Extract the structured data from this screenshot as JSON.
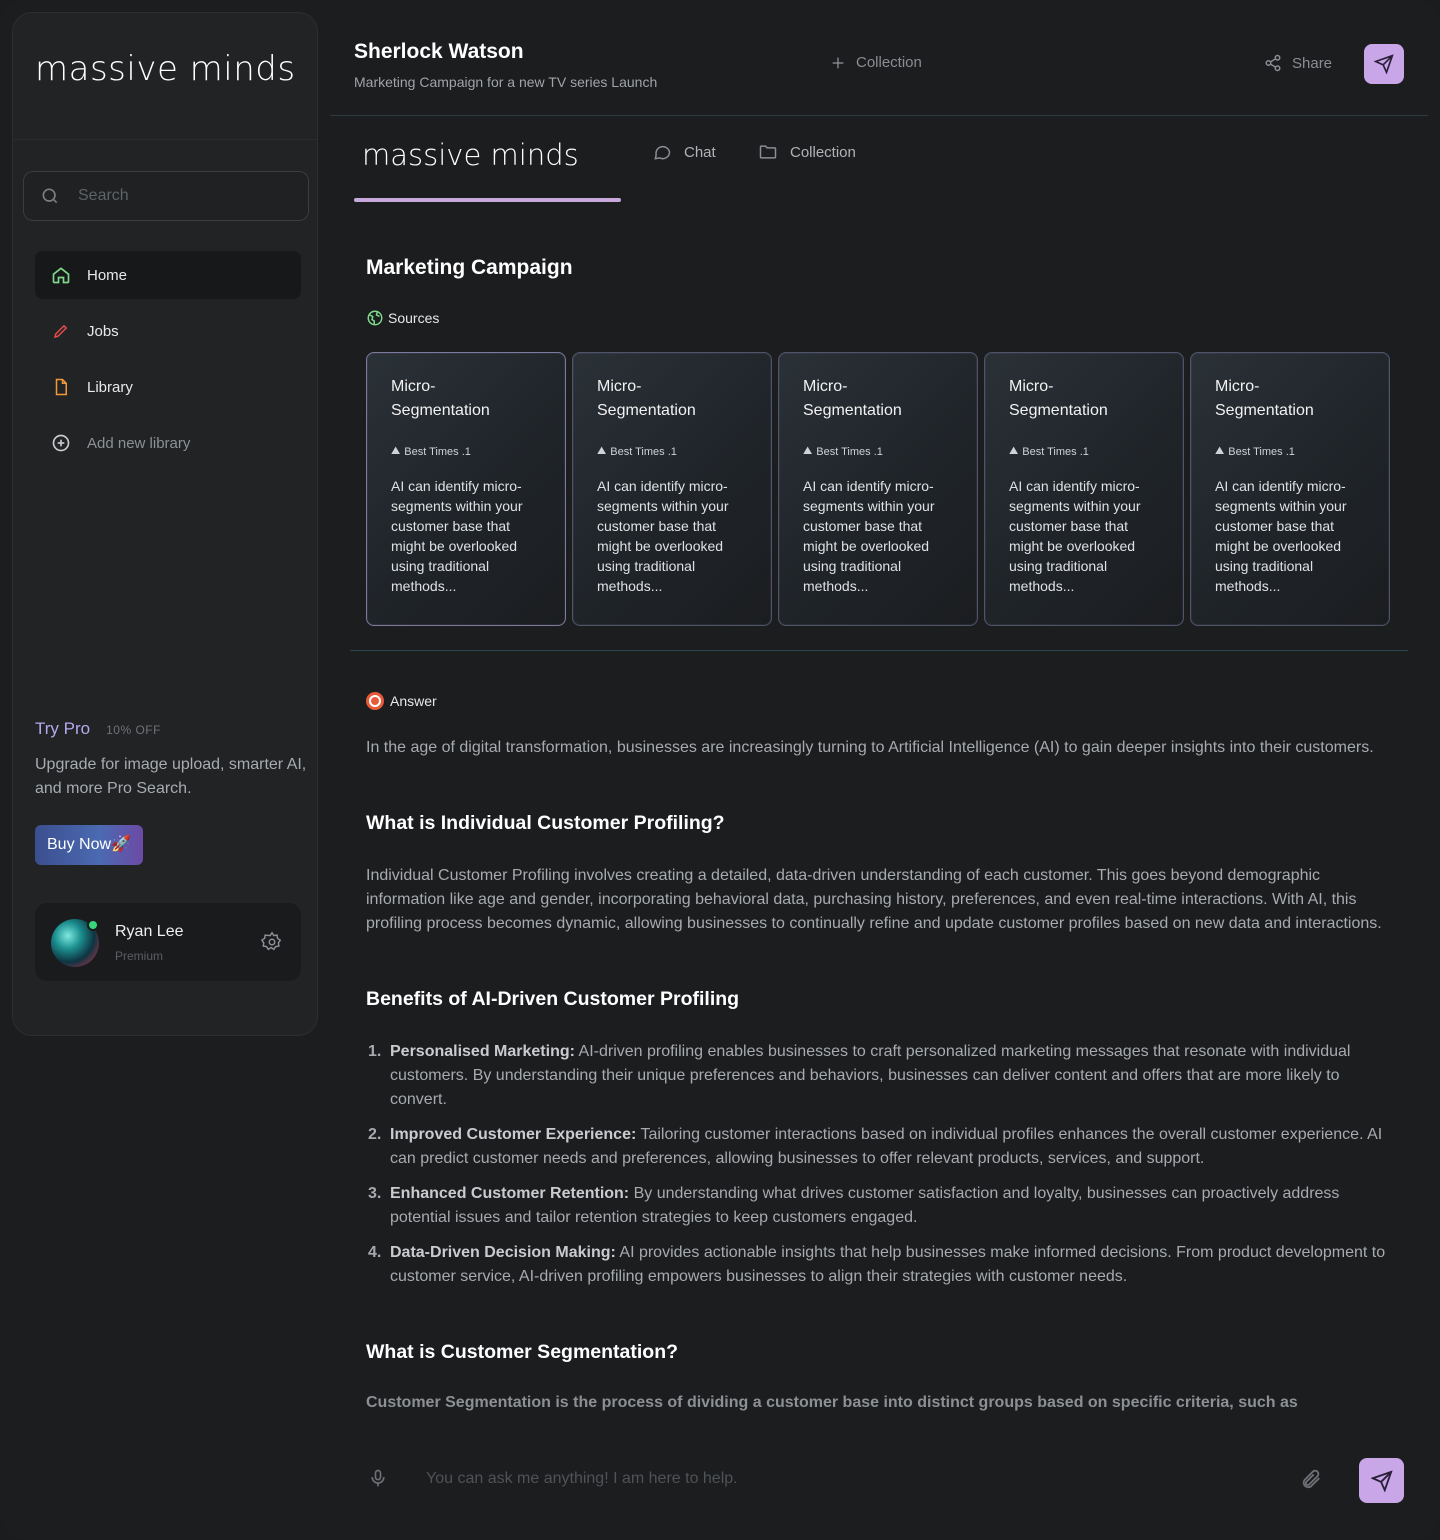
{
  "sidebar": {
    "logo": "massive  minds",
    "search_placeholder": "Search",
    "nav": [
      {
        "label": "Home",
        "icon": "home-icon"
      },
      {
        "label": "Jobs",
        "icon": "pencil-icon"
      },
      {
        "label": "Library",
        "icon": "file-icon"
      },
      {
        "label": "Add new library",
        "icon": "plus-circle-icon"
      }
    ],
    "trypro": {
      "title": "Try Pro",
      "badge": "10% OFF",
      "desc": "Upgrade for image upload, smarter AI, and more Pro Search.",
      "button": "Buy Now🚀"
    },
    "profile": {
      "name": "Ryan Lee",
      "tier": "Premium"
    }
  },
  "header": {
    "title": "Sherlock Watson",
    "subtitle": "Marketing Campaign for a new TV series Launch",
    "collection": "Collection",
    "share": "Share"
  },
  "tabs": {
    "brand": "massive  minds",
    "chat": "Chat",
    "collection": "Collection"
  },
  "content": {
    "heading": "Marketing Campaign",
    "sources_label": "Sources",
    "cards": [
      {
        "title": "Micro-\nSegmentation",
        "meta": "Best Times .1",
        "body": "AI can identify micro-segments within your customer base that might be overlooked using traditional methods..."
      },
      {
        "title": "Micro-\nSegmentation",
        "meta": "Best Times .1",
        "body": "AI can identify micro-segments within your customer base that might be overlooked using traditional methods..."
      },
      {
        "title": "Micro-\nSegmentation",
        "meta": "Best Times .1",
        "body": "AI can identify micro-segments within your customer base that might be overlooked using traditional methods..."
      },
      {
        "title": "Micro-\nSegmentation",
        "meta": "Best Times .1",
        "body": "AI can identify micro-segments within your customer base that might be overlooked using traditional methods..."
      },
      {
        "title": "Micro-\nSegmentation",
        "meta": "Best Times .1",
        "body": "AI can identify micro-segments within your customer base that might be overlooked using traditional methods..."
      }
    ],
    "answer_label": "Answer",
    "intro": "In the age of digital transformation, businesses are increasingly turning to Artificial Intelligence (AI) to gain deeper insights into their customers.",
    "h_profiling": "What is Individual Customer Profiling?",
    "p_profiling": "Individual Customer Profiling involves creating a detailed, data-driven understanding of each customer. This goes beyond demographic information like age and gender, incorporating behavioral data, purchasing history, preferences, and even real-time interactions. With AI, this profiling process becomes dynamic, allowing businesses to continually refine and update customer profiles based on new data and interactions.",
    "h_benefits": "Benefits of AI-Driven Customer Profiling",
    "benefits": [
      {
        "num": "1.",
        "title": "Personalised Marketing:",
        "text": " AI-driven profiling enables businesses to craft personalized marketing messages that resonate with individual customers. By understanding their unique preferences and behaviors, businesses can deliver content and offers that are more likely to convert."
      },
      {
        "num": "2.",
        "title": "Improved Customer Experience:",
        "text": " Tailoring customer interactions based on individual profiles enhances the overall customer experience. AI can predict customer needs and preferences, allowing businesses to offer relevant products, services, and support."
      },
      {
        "num": "3.",
        "title": "Enhanced Customer Retention:",
        "text": " By understanding what drives customer satisfaction and loyalty, businesses can proactively address potential issues and tailor retention strategies to keep customers engaged."
      },
      {
        "num": "4.",
        "title": "Data-Driven Decision Making:",
        "text": " AI provides actionable insights that help businesses make informed decisions. From product development to customer service, AI-driven profiling empowers businesses to align their strategies with customer needs."
      }
    ],
    "h_segmentation": "What is Customer Segmentation?",
    "p_segmentation": "Customer Segmentation is the process of dividing a customer base into distinct groups based on specific criteria, such as"
  },
  "composer": {
    "placeholder": "You can ask me anything! I am here to help."
  },
  "colors": {
    "accent": "#c8a6e8",
    "background": "#1c1d1f",
    "sidebar": "#212325",
    "pro": "#b7a7f0"
  }
}
